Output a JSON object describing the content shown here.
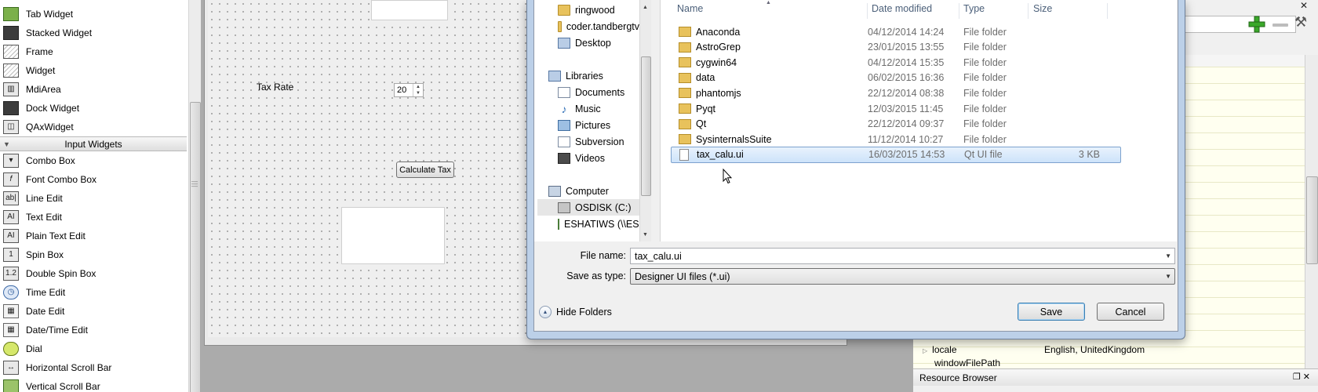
{
  "widget_box": {
    "items_top": [
      {
        "label": "Tab Widget",
        "icon": "tab-widget-icon"
      },
      {
        "label": "Stacked Widget",
        "icon": "stacked-widget-icon"
      },
      {
        "label": "Frame",
        "icon": "frame-icon"
      },
      {
        "label": "Widget",
        "icon": "widget-icon"
      },
      {
        "label": "MdiArea",
        "icon": "mdi-area-icon"
      },
      {
        "label": "Dock Widget",
        "icon": "dock-widget-icon"
      },
      {
        "label": "QAxWidget",
        "icon": "qaxwidget-icon"
      }
    ],
    "category": "Input Widgets",
    "items_input": [
      {
        "label": "Combo Box",
        "icon": "combo-box-icon"
      },
      {
        "label": "Font Combo Box",
        "icon": "font-combo-box-icon"
      },
      {
        "label": "Line Edit",
        "icon": "line-edit-icon"
      },
      {
        "label": "Text Edit",
        "icon": "text-edit-icon"
      },
      {
        "label": "Plain Text Edit",
        "icon": "plain-text-edit-icon"
      },
      {
        "label": "Spin Box",
        "icon": "spin-box-icon"
      },
      {
        "label": "Double Spin Box",
        "icon": "double-spin-box-icon"
      },
      {
        "label": "Time Edit",
        "icon": "time-edit-icon"
      },
      {
        "label": "Date Edit",
        "icon": "date-edit-icon"
      },
      {
        "label": "Date/Time Edit",
        "icon": "date-time-edit-icon"
      },
      {
        "label": "Dial",
        "icon": "dial-icon"
      },
      {
        "label": "Horizontal Scroll Bar",
        "icon": "horizontal-scroll-bar-icon"
      },
      {
        "label": "Vertical Scroll Bar",
        "icon": "vertical-scroll-bar-icon"
      }
    ]
  },
  "form": {
    "tax_rate_label": "Tax Rate",
    "tax_rate_value": "20",
    "calculate_button": "Calculate Tax"
  },
  "dialog": {
    "nav": {
      "ringwood": "ringwood",
      "coder": "coder.tandbergtv",
      "desktop": "Desktop",
      "libraries": "Libraries",
      "documents": "Documents",
      "music": "Music",
      "pictures": "Pictures",
      "subversion": "Subversion",
      "videos": "Videos",
      "computer": "Computer",
      "osdisk": "OSDISK (C:)",
      "eshatiws": "ESHATIWS (\\\\ESE"
    },
    "columns": {
      "name": "Name",
      "date": "Date modified",
      "type": "Type",
      "size": "Size"
    },
    "files": [
      {
        "name": "Anaconda",
        "date": "04/12/2014 14:24",
        "type": "File folder",
        "size": "",
        "kind": "folder"
      },
      {
        "name": "AstroGrep",
        "date": "23/01/2015 13:55",
        "type": "File folder",
        "size": "",
        "kind": "folder"
      },
      {
        "name": "cygwin64",
        "date": "04/12/2014 15:35",
        "type": "File folder",
        "size": "",
        "kind": "folder"
      },
      {
        "name": "data",
        "date": "06/02/2015 16:36",
        "type": "File folder",
        "size": "",
        "kind": "folder"
      },
      {
        "name": "phantomjs",
        "date": "22/12/2014 08:38",
        "type": "File folder",
        "size": "",
        "kind": "folder"
      },
      {
        "name": "Pyqt",
        "date": "12/03/2015 11:45",
        "type": "File folder",
        "size": "",
        "kind": "folder"
      },
      {
        "name": "Qt",
        "date": "22/12/2014 09:37",
        "type": "File folder",
        "size": "",
        "kind": "folder"
      },
      {
        "name": "SysinternalsSuite",
        "date": "11/12/2014 10:27",
        "type": "File folder",
        "size": "",
        "kind": "folder"
      },
      {
        "name": "tax_calu.ui",
        "date": "16/03/2015 14:53",
        "type": "Qt UI file",
        "size": "3 KB",
        "kind": "file",
        "selected": true
      }
    ],
    "file_name_label": "File name:",
    "file_name_value": "tax_calu.ui",
    "save_type_label": "Save as type:",
    "save_type_value": "Designer UI files (*.ui)",
    "hide_folders": "Hide Folders",
    "save_button": "Save",
    "cancel_button": "Cancel"
  },
  "property_editor": {
    "locale_name": "locale",
    "locale_value": "English, UnitedKingdom",
    "window_file_path": "windowFilePath"
  },
  "resource_browser": {
    "title": "Resource Browser"
  },
  "colors": {
    "selection": "#cde3fa",
    "property_bg": "#fffff0",
    "accent_green": "#3aa82a"
  }
}
